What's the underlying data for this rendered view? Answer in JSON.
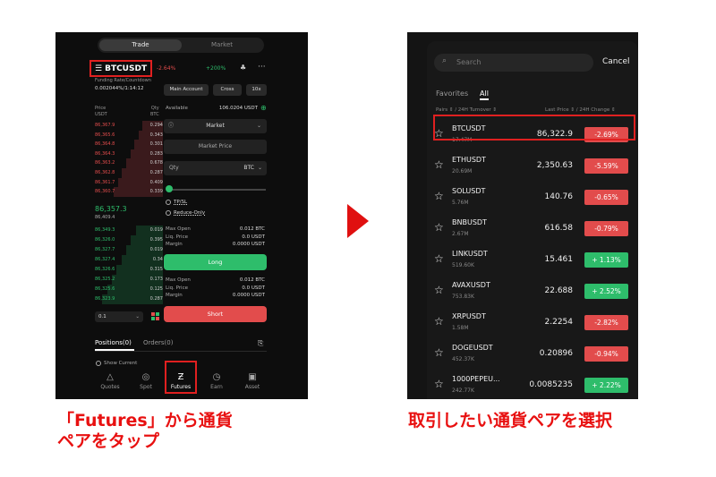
{
  "colors": {
    "red": "#e24c4c",
    "green": "#2ebd6b",
    "highlight": "#e02020",
    "arrow": "#e01010"
  },
  "left": {
    "tabs": [
      "Trade",
      "Market"
    ],
    "pair": "BTCUSDT",
    "pair_change": "-2.64%",
    "top_rate": "+200%",
    "funding_label": "Funding Rate/Countdown",
    "funding_value": "0.002044%/1:14:12",
    "buttons": [
      "Main Account",
      "Cross",
      "10x"
    ],
    "orderbook_headers": {
      "price": "Price\nUSDT",
      "qty": "Qty\nBTC"
    },
    "asks": [
      {
        "p": "86,367.9",
        "q": "0.294"
      },
      {
        "p": "86,365.6",
        "q": "0.343"
      },
      {
        "p": "86,364.8",
        "q": "0.301"
      },
      {
        "p": "86,364.3",
        "q": "0.283"
      },
      {
        "p": "86,363.2",
        "q": "0.678"
      },
      {
        "p": "86,362.8",
        "q": "0.287"
      },
      {
        "p": "86,361.7",
        "q": "0.409"
      },
      {
        "p": "86,360.7",
        "q": "0.339"
      }
    ],
    "mid_price": "86,357.3",
    "mid_sub": "86,409.4",
    "bids": [
      {
        "p": "86,349.3",
        "q": "0.019"
      },
      {
        "p": "86,326.0",
        "q": "0.395"
      },
      {
        "p": "86,327.7",
        "q": "0.019"
      },
      {
        "p": "86,327.4",
        "q": "0.34"
      },
      {
        "p": "86,326.6",
        "q": "0.315"
      },
      {
        "p": "86,325.2",
        "q": "0.173"
      },
      {
        "p": "86,325.6",
        "q": "0.125"
      },
      {
        "p": "86,323.9",
        "q": "0.287"
      }
    ],
    "available_label": "Available",
    "available_value": "106.0204 USDT",
    "order_type": "Market",
    "market_price": "Market Price",
    "qty_label": "Qty",
    "qty_unit": "BTC",
    "tpsl": "TP/SL",
    "reduce_only": "Reduce-Only",
    "long_info": [
      {
        "l": "Max Open",
        "v": "0.012 BTC"
      },
      {
        "l": "Liq. Price",
        "v": "0.0 USDT"
      },
      {
        "l": "Margin",
        "v": "0.0000 USDT"
      }
    ],
    "long_label": "Long",
    "short_info": [
      {
        "l": "Max Open",
        "v": "0.012 BTC"
      },
      {
        "l": "Liq. Price",
        "v": "0.0 USDT"
      },
      {
        "l": "Margin",
        "v": "0.0000 USDT"
      }
    ],
    "short_label": "Short",
    "depth": "0.1",
    "positions_tab": "Positions(0)",
    "orders_tab": "Orders(0)",
    "show_current": "Show Current",
    "nav": [
      {
        "label": "Quotes",
        "icon": "△"
      },
      {
        "label": "Spot",
        "icon": "◎"
      },
      {
        "label": "Futures",
        "icon": "Ƶ"
      },
      {
        "label": "Earn",
        "icon": "◷"
      },
      {
        "label": "Asset",
        "icon": "▣"
      }
    ]
  },
  "right": {
    "search_placeholder": "Search",
    "cancel": "Cancel",
    "tabs": [
      "Favorites",
      "All"
    ],
    "col_pairs": "Pairs ⇕ / 24H Turnover ⇕",
    "col_price": "Last Price ⇕ / 24H Change ⇕",
    "rows": [
      {
        "sym": "BTCUSDT",
        "vol": "17.47M",
        "price": "86,322.9",
        "chg": "-2.69%",
        "up": false
      },
      {
        "sym": "ETHUSDT",
        "vol": "20.69M",
        "price": "2,350.63",
        "chg": "-5.59%",
        "up": false
      },
      {
        "sym": "SOLUSDT",
        "vol": "5.76M",
        "price": "140.76",
        "chg": "-0.65%",
        "up": false
      },
      {
        "sym": "BNBUSDT",
        "vol": "2.67M",
        "price": "616.58",
        "chg": "-0.79%",
        "up": false
      },
      {
        "sym": "LINKUSDT",
        "vol": "519.60K",
        "price": "15.461",
        "chg": "+ 1.13%",
        "up": true
      },
      {
        "sym": "AVAXUSDT",
        "vol": "753.83K",
        "price": "22.688",
        "chg": "+ 2.52%",
        "up": true
      },
      {
        "sym": "XRPUSDT",
        "vol": "1.58M",
        "price": "2.2254",
        "chg": "-2.82%",
        "up": false
      },
      {
        "sym": "DOGEUSDT",
        "vol": "452.37K",
        "price": "0.20896",
        "chg": "-0.94%",
        "up": false
      },
      {
        "sym": "1000PEPEU...",
        "vol": "242.77K",
        "price": "0.0085235",
        "chg": "+ 2.22%",
        "up": true
      }
    ]
  },
  "captions": {
    "left_line1": "「Futures」から通貨",
    "left_line2": "ペアをタップ",
    "right": "取引したい通貨ペアを選択"
  }
}
